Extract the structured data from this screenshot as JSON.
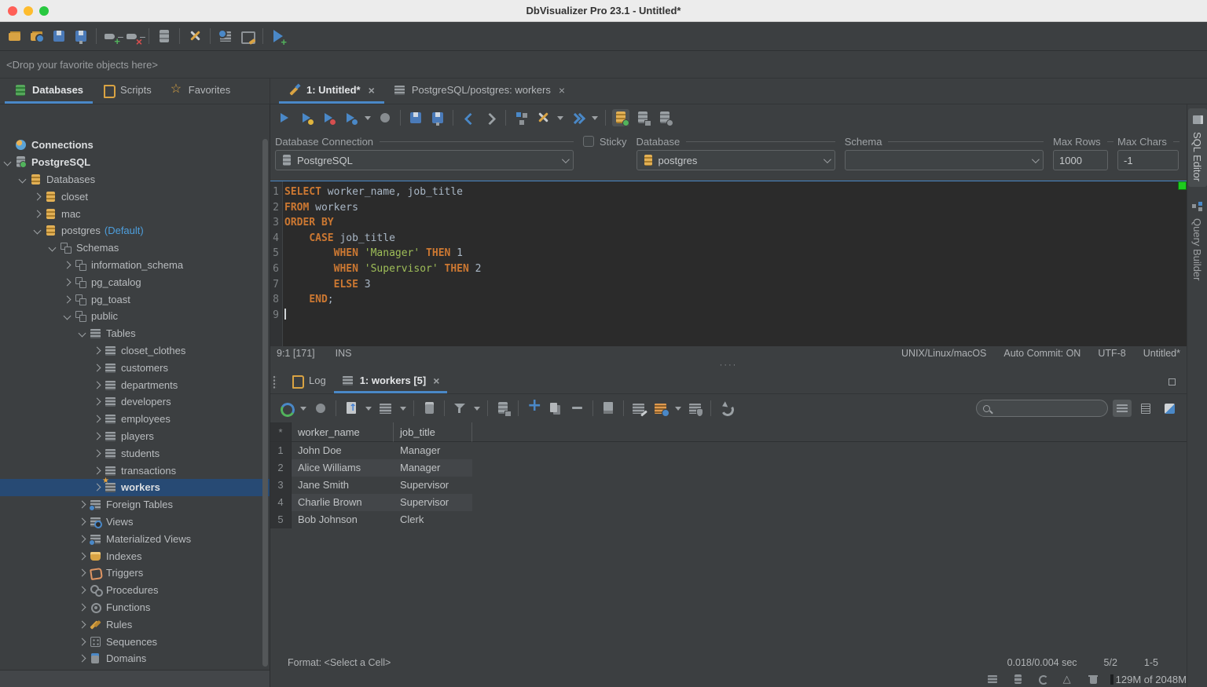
{
  "window": {
    "title": "DbVisualizer Pro 23.1 - Untitled*"
  },
  "colors": {
    "accent": "#4a88c7",
    "keyword": "#cc7832",
    "string": "#9fbe58",
    "selection": "#274a74",
    "traffic_lights": [
      "#ff5f57",
      "#febc2e",
      "#28c840"
    ]
  },
  "main_toolbar": {
    "icons": [
      "folder-open",
      "folder-badge",
      "save",
      "save-as",
      "sep",
      "connect",
      "disconnect",
      "sep",
      "server",
      "sep",
      "tools",
      "sep",
      "table-clock",
      "monitor-pen",
      "sep",
      "play-plus"
    ]
  },
  "favorites_bar": {
    "text": "<Drop your favorite objects here>"
  },
  "nav_tabs": {
    "left": [
      {
        "label": "Databases",
        "icon": "database",
        "active": true
      },
      {
        "label": "Scripts",
        "icon": "book"
      },
      {
        "label": "Favorites",
        "icon": "star"
      }
    ],
    "editor_tabs": [
      {
        "label": "1: Untitled*",
        "icon": "pencil",
        "active": true,
        "closable": true
      },
      {
        "label": "PostgreSQL/postgres: workers",
        "icon": "table",
        "closable": true
      }
    ]
  },
  "sidebar": {
    "tree": [
      {
        "l": 0,
        "t": "Connections",
        "i": "globe",
        "a": 0,
        "b": 1
      },
      {
        "l": 0,
        "t": "PostgreSQL",
        "i": "server",
        "a": 1,
        "b": 1
      },
      {
        "l": 1,
        "t": "Databases",
        "i": "db",
        "a": 1
      },
      {
        "l": 2,
        "t": "closet",
        "i": "db",
        "a": 2
      },
      {
        "l": 2,
        "t": "mac",
        "i": "db",
        "a": 2
      },
      {
        "l": 2,
        "t": "postgres",
        "sfx": "(Default)",
        "i": "db",
        "a": 1
      },
      {
        "l": 3,
        "t": "Schemas",
        "i": "schema",
        "a": 1
      },
      {
        "l": 4,
        "t": "information_schema",
        "i": "schema",
        "a": 2
      },
      {
        "l": 4,
        "t": "pg_catalog",
        "i": "schema",
        "a": 2
      },
      {
        "l": 4,
        "t": "pg_toast",
        "i": "schema",
        "a": 2
      },
      {
        "l": 4,
        "t": "public",
        "i": "schema",
        "a": 1
      },
      {
        "l": 5,
        "t": "Tables",
        "i": "table",
        "a": 1
      },
      {
        "l": 6,
        "t": "closet_clothes",
        "i": "table",
        "a": 2
      },
      {
        "l": 6,
        "t": "customers",
        "i": "table",
        "a": 2
      },
      {
        "l": 6,
        "t": "departments",
        "i": "table",
        "a": 2
      },
      {
        "l": 6,
        "t": "developers",
        "i": "table",
        "a": 2
      },
      {
        "l": 6,
        "t": "employees",
        "i": "table",
        "a": 2
      },
      {
        "l": 6,
        "t": "players",
        "i": "table",
        "a": 2
      },
      {
        "l": 6,
        "t": "students",
        "i": "table",
        "a": 2
      },
      {
        "l": 6,
        "t": "transactions",
        "i": "table",
        "a": 2
      },
      {
        "l": 6,
        "t": "workers",
        "i": "table-star",
        "a": 2,
        "b": 1,
        "sel": 1
      },
      {
        "l": 5,
        "t": "Foreign Tables",
        "i": "table-dot",
        "a": 2
      },
      {
        "l": 5,
        "t": "Views",
        "i": "table-search",
        "a": 2
      },
      {
        "l": 5,
        "t": "Materialized Views",
        "i": "table-dot",
        "a": 2
      },
      {
        "l": 5,
        "t": "Indexes",
        "i": "index",
        "a": 2
      },
      {
        "l": 5,
        "t": "Triggers",
        "i": "trigger",
        "a": 2
      },
      {
        "l": 5,
        "t": "Procedures",
        "i": "gears",
        "a": 2
      },
      {
        "l": 5,
        "t": "Functions",
        "i": "gear",
        "a": 2
      },
      {
        "l": 5,
        "t": "Rules",
        "i": "gavel",
        "a": 2
      },
      {
        "l": 5,
        "t": "Sequences",
        "i": "dice",
        "a": 2
      },
      {
        "l": 5,
        "t": "Domains",
        "i": "jar",
        "a": 2
      }
    ]
  },
  "editor": {
    "toolbar_icons": [
      "play",
      "play-yellow",
      "play-red",
      "play-blue",
      "chev",
      "stop",
      "sep",
      "save",
      "save-as",
      "sep",
      "back",
      "fwd",
      "sep",
      "orgchart",
      "tools",
      "chev",
      "runto",
      "chev",
      "sep",
      "db-active",
      "db-save",
      "db-gray"
    ],
    "form": {
      "connection_label": "Database Connection",
      "connection_value": "PostgreSQL",
      "sticky_label": "Sticky",
      "database_label": "Database",
      "database_value": "postgres",
      "schema_label": "Schema",
      "schema_value": "",
      "max_rows_label": "Max Rows",
      "max_rows_value": "1000",
      "max_chars_label": "Max Chars",
      "max_chars_value": "-1"
    },
    "code": [
      {
        "n": "1",
        "s": [
          [
            "k",
            "SELECT"
          ],
          [
            "p",
            " worker_name, job_title"
          ]
        ]
      },
      {
        "n": "2",
        "s": [
          [
            "k",
            "FROM"
          ],
          [
            "p",
            " workers"
          ]
        ]
      },
      {
        "n": "3",
        "s": [
          [
            "k",
            "ORDER BY"
          ]
        ]
      },
      {
        "n": "4",
        "s": [
          [
            "p",
            "    "
          ],
          [
            "k",
            "CASE"
          ],
          [
            "p",
            " job_title"
          ]
        ]
      },
      {
        "n": "5",
        "s": [
          [
            "p",
            "        "
          ],
          [
            "k",
            "WHEN"
          ],
          [
            "p",
            " "
          ],
          [
            "s",
            "'Manager'"
          ],
          [
            "p",
            " "
          ],
          [
            "k",
            "THEN"
          ],
          [
            "p",
            " 1"
          ]
        ]
      },
      {
        "n": "6",
        "s": [
          [
            "p",
            "        "
          ],
          [
            "k",
            "WHEN"
          ],
          [
            "p",
            " "
          ],
          [
            "s",
            "'Supervisor'"
          ],
          [
            "p",
            " "
          ],
          [
            "k",
            "THEN"
          ],
          [
            "p",
            " 2"
          ]
        ]
      },
      {
        "n": "7",
        "s": [
          [
            "p",
            "        "
          ],
          [
            "k",
            "ELSE"
          ],
          [
            "p",
            " 3"
          ]
        ]
      },
      {
        "n": "8",
        "s": [
          [
            "p",
            "    "
          ],
          [
            "k",
            "END"
          ],
          [
            "p",
            ";"
          ]
        ]
      },
      {
        "n": "9",
        "s": [],
        "cursor": true
      }
    ],
    "status": {
      "caret": "9:1 [171]",
      "mode": "INS",
      "platform": "UNIX/Linux/macOS",
      "autocommit": "Auto Commit: ON",
      "encoding": "UTF-8",
      "doc": "Untitled*"
    }
  },
  "results": {
    "tabs": [
      {
        "label": "Log",
        "icon": "book"
      },
      {
        "label": "1: workers [5]",
        "icon": "table",
        "active": true,
        "closable": true
      }
    ],
    "toolbar_icons": [
      "refresh",
      "chev",
      "stop",
      "sep",
      "export",
      "chev",
      "grid",
      "chev",
      "sep",
      "calc",
      "sep",
      "filter",
      "chev",
      "sep",
      "db-save",
      "sep",
      "plus",
      "copy",
      "minus",
      "sep",
      "edit-page",
      "sep",
      "grid-edit",
      "grid-gear",
      "chev",
      "grid-shield",
      "sep",
      "undo"
    ],
    "search": {
      "value": ""
    },
    "view_buttons": [
      "grid-view",
      "form-view",
      "split-view"
    ],
    "grid": {
      "row_header": "*",
      "columns": [
        "worker_name",
        "job_title"
      ],
      "rows": [
        [
          "John Doe",
          "Manager"
        ],
        [
          "Alice Williams",
          "Manager"
        ],
        [
          "Jane Smith",
          "Supervisor"
        ],
        [
          "Charlie Brown",
          "Supervisor"
        ],
        [
          "Bob Johnson",
          "Clerk"
        ]
      ]
    },
    "footer": {
      "format_label": "Format: <Select a Cell>",
      "time": "0.018/0.004 sec",
      "rows_cols": "5/2",
      "range": "1-5"
    }
  },
  "right_panel": {
    "tabs": [
      {
        "label": "SQL Editor",
        "icon": "doc",
        "active": true
      },
      {
        "label": "Query Builder",
        "icon": "orgchart"
      }
    ]
  },
  "statusbar": {
    "bottom_icons": [
      "mini-grid",
      "mini-db",
      "mini-sync",
      "mini-warn",
      "mini-trash"
    ],
    "memory": "129M of 2048M"
  }
}
